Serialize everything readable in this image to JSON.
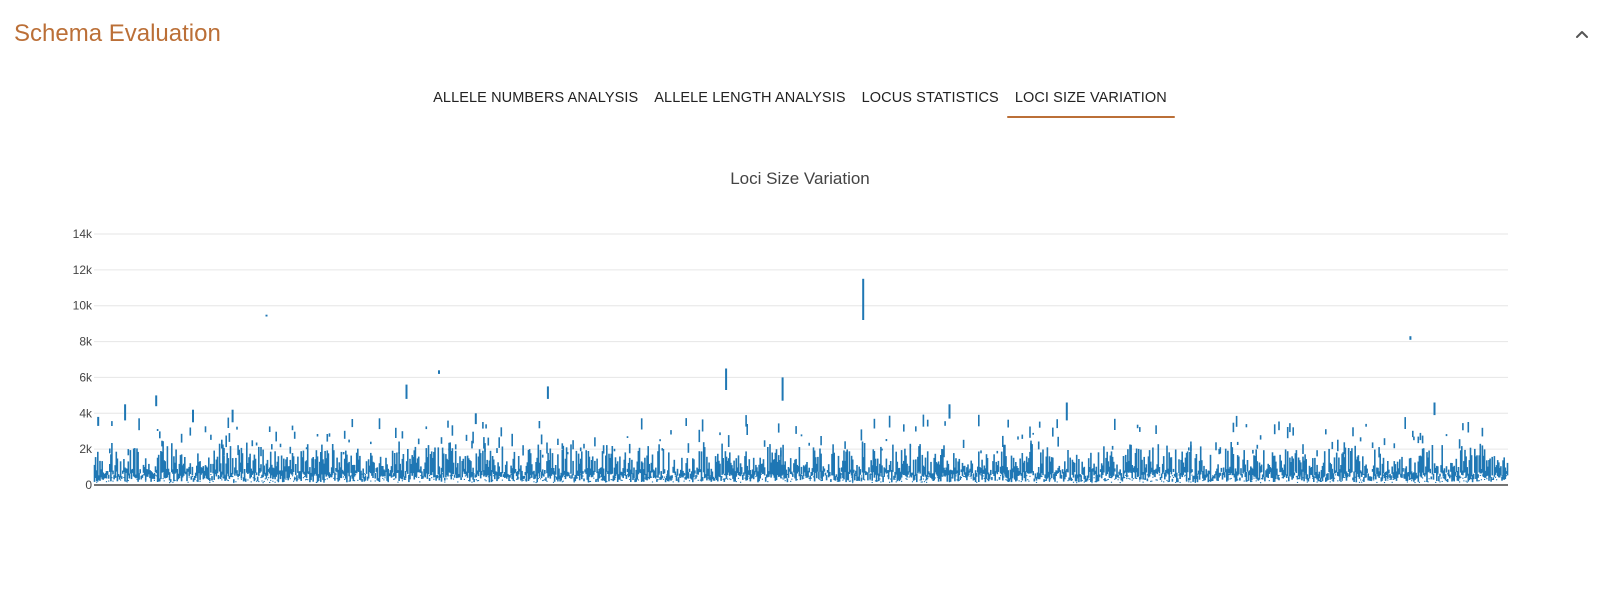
{
  "panel": {
    "title": "Schema Evaluation",
    "collapse_icon": "chevron-up-icon"
  },
  "tabs": [
    {
      "label": "ALLELE NUMBERS ANALYSIS",
      "active": false
    },
    {
      "label": "ALLELE LENGTH ANALYSIS",
      "active": false
    },
    {
      "label": "LOCUS STATISTICS",
      "active": false
    },
    {
      "label": "LOCI SIZE VARIATION",
      "active": true
    }
  ],
  "colors": {
    "accent": "#bb6f37",
    "series": "#1f77b4",
    "grid": "#e6e6e6",
    "text": "#444444"
  },
  "chart_data": {
    "type": "box",
    "title": "Loci Size Variation",
    "xlabel": "",
    "ylabel": "",
    "ylim": [
      0,
      14000
    ],
    "yticks": [
      0,
      2000,
      4000,
      6000,
      8000,
      10000,
      12000,
      14000
    ],
    "ytick_labels": [
      "0",
      "2k",
      "4k",
      "6k",
      "8k",
      "10k",
      "12k",
      "14k"
    ],
    "grid": true,
    "legend": "none",
    "x_tick_labels_visible": false,
    "n_loci_approx": 1300,
    "outlier_loci": [
      {
        "x_frac": 0.003,
        "min": 3300,
        "max": 3800
      },
      {
        "x_frac": 0.022,
        "min": 3600,
        "max": 4500
      },
      {
        "x_frac": 0.044,
        "min": 4400,
        "max": 5000
      },
      {
        "x_frac": 0.07,
        "min": 3500,
        "max": 4200
      },
      {
        "x_frac": 0.098,
        "min": 3500,
        "max": 4200
      },
      {
        "x_frac": 0.122,
        "min": 9400,
        "max": 9500
      },
      {
        "x_frac": 0.221,
        "min": 4800,
        "max": 5600
      },
      {
        "x_frac": 0.244,
        "min": 6200,
        "max": 6400
      },
      {
        "x_frac": 0.27,
        "min": 3400,
        "max": 4000
      },
      {
        "x_frac": 0.321,
        "min": 4800,
        "max": 5500
      },
      {
        "x_frac": 0.447,
        "min": 5300,
        "max": 6500
      },
      {
        "x_frac": 0.487,
        "min": 4700,
        "max": 6000
      },
      {
        "x_frac": 0.544,
        "min": 9200,
        "max": 11500
      },
      {
        "x_frac": 0.605,
        "min": 3700,
        "max": 4500
      },
      {
        "x_frac": 0.688,
        "min": 3600,
        "max": 4600
      },
      {
        "x_frac": 0.931,
        "min": 8100,
        "max": 8300
      },
      {
        "x_frac": 0.948,
        "min": 3900,
        "max": 4600
      }
    ]
  }
}
